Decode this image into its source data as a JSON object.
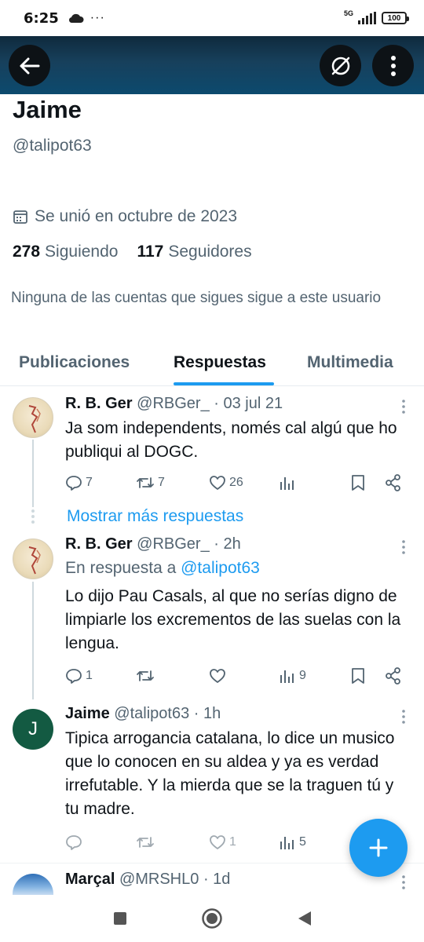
{
  "status_bar": {
    "time": "6:25",
    "network": "5G",
    "battery": "100"
  },
  "profile": {
    "name": "Jaime",
    "handle": "@talipot63",
    "joined": "Se unió en octubre de 2023",
    "following_count": "278",
    "following_label": "Siguiendo",
    "followers_count": "117",
    "followers_label": "Seguidores",
    "not_followed_notice": "Ninguna de las cuentas que sigues sigue a este usuario"
  },
  "tabs": [
    "Publicaciones",
    "Respuestas",
    "Multimedia"
  ],
  "active_tab": "Respuestas",
  "tweets": [
    {
      "name": "R. B. Ger",
      "handle": "@RBGer_",
      "time": "· 03 jul 21",
      "text": "Ja som independents, només cal algú que ho publiqui al DOGC.",
      "replies": "7",
      "retweets": "7",
      "likes": "26",
      "views": ""
    },
    {
      "name": "R. B. Ger",
      "handle": "@RBGer_",
      "time": "· 2h",
      "reply_prefix": "En respuesta a",
      "reply_to": "@talipot63",
      "text": "Lo dijo Pau Casals, al que no serías digno de limpiarle los excrementos de las suelas con la lengua.",
      "replies": "1",
      "retweets": "",
      "likes": "",
      "views": "9"
    },
    {
      "name": "Jaime",
      "handle": "@talipot63",
      "time": "· 1h",
      "avatar_letter": "J",
      "text": "Tipica arrogancia catalana, lo dice un musico que lo conocen en su aldea y ya es verdad irrefutable. Y la mierda que se la traguen tú y tu madre.",
      "replies": "",
      "retweets": "",
      "likes": "1",
      "views": "5"
    },
    {
      "name": "Marçal",
      "handle": "@MRSHL0",
      "time": "· 1d"
    }
  ],
  "show_more": "Mostrar más respuestas",
  "colors": {
    "accent": "#1d9bf0",
    "muted": "#536471",
    "text": "#0f1419",
    "header": "#17405c"
  }
}
